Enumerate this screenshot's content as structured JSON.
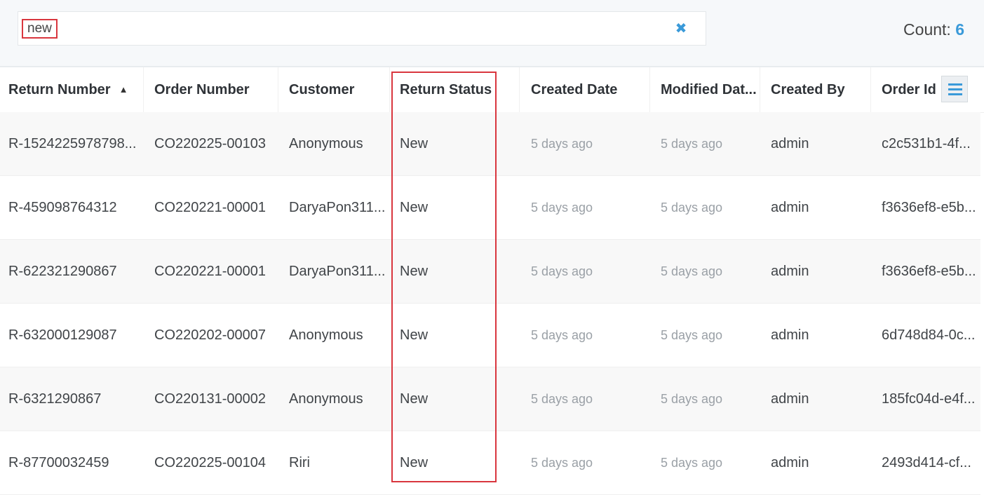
{
  "search": {
    "value": "new",
    "clear_icon": "✖"
  },
  "count": {
    "label": "Count:",
    "value": "6"
  },
  "columns": [
    {
      "label": "Return Number",
      "sort": "ascending"
    },
    {
      "label": "Order Number"
    },
    {
      "label": "Customer"
    },
    {
      "label": "Return Status"
    },
    {
      "label": "Created Date"
    },
    {
      "label": "Modified Dat..."
    },
    {
      "label": "Created By"
    },
    {
      "label": "Order Id"
    }
  ],
  "column_menu_icon": "hamburger-menu-icon",
  "rows": [
    {
      "return_number": "R-1524225978798...",
      "order_number": "CO220225-00103",
      "customer": "Anonymous",
      "status": "New",
      "created": "5 days ago",
      "modified": "5 days ago",
      "created_by": "admin",
      "order_id": "c2c531b1-4f..."
    },
    {
      "return_number": "R-459098764312",
      "order_number": "CO220221-00001",
      "customer": "DaryaPon311...",
      "status": "New",
      "created": "5 days ago",
      "modified": "5 days ago",
      "created_by": "admin",
      "order_id": "f3636ef8-e5b..."
    },
    {
      "return_number": "R-622321290867",
      "order_number": "CO220221-00001",
      "customer": "DaryaPon311...",
      "status": "New",
      "created": "5 days ago",
      "modified": "5 days ago",
      "created_by": "admin",
      "order_id": "f3636ef8-e5b..."
    },
    {
      "return_number": "R-632000129087",
      "order_number": "CO220202-00007",
      "customer": "Anonymous",
      "status": "New",
      "created": "5 days ago",
      "modified": "5 days ago",
      "created_by": "admin",
      "order_id": "6d748d84-0c..."
    },
    {
      "return_number": "R-6321290867",
      "order_number": "CO220131-00002",
      "customer": "Anonymous",
      "status": "New",
      "created": "5 days ago",
      "modified": "5 days ago",
      "created_by": "admin",
      "order_id": "185fc04d-e4f..."
    },
    {
      "return_number": "R-87700032459",
      "order_number": "CO220225-00104",
      "customer": "Riri",
      "status": "New",
      "created": "5 days ago",
      "modified": "5 days ago",
      "created_by": "admin",
      "order_id": "2493d414-cf..."
    }
  ],
  "colors": {
    "accent": "#3a9ad9",
    "highlight": "#d9363e"
  }
}
